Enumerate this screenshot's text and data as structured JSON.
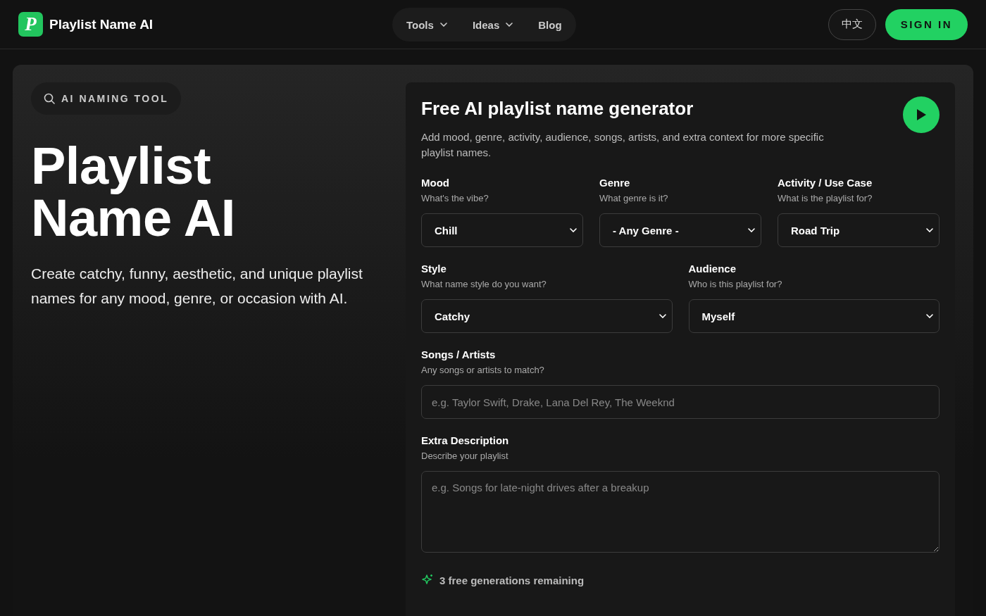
{
  "header": {
    "logo_letter": "P",
    "brand": "Playlist Name AI",
    "nav": [
      {
        "label": "Tools",
        "dropdown": true
      },
      {
        "label": "Ideas",
        "dropdown": true
      },
      {
        "label": "Blog",
        "dropdown": false
      }
    ],
    "language": "中文",
    "sign_in": "SIGN IN"
  },
  "hero": {
    "badge": "AI NAMING TOOL",
    "title_lines": [
      "Playlist",
      "Name AI"
    ],
    "subtitle": "Create catchy, funny, aesthetic, and unique playlist names for any mood, genre, or occasion with AI."
  },
  "generator": {
    "title": "Free AI playlist name generator",
    "description": "Add mood, genre, activity, audience, songs, artists, and extra context for more specific playlist names.",
    "field_groups": [
      {
        "fields": [
          {
            "kind": "select",
            "label": "Mood",
            "hint": "What's the vibe?",
            "value": "Chill"
          },
          {
            "kind": "select",
            "label": "Genre",
            "hint": "What genre is it?",
            "value": "- Any Genre -"
          },
          {
            "kind": "select",
            "label": "Activity / Use Case",
            "hint": "What is the playlist for?",
            "value": "Road Trip"
          }
        ]
      },
      {
        "fields": [
          {
            "kind": "select",
            "label": "Style",
            "hint": "What name style do you want?",
            "value": "Catchy"
          },
          {
            "kind": "select",
            "label": "Audience",
            "hint": "Who is this playlist for?",
            "value": "Myself"
          }
        ]
      },
      {
        "fields": [
          {
            "kind": "input",
            "label": "Songs / Artists",
            "hint": "Any songs or artists to match?",
            "placeholder": "e.g. Taylor Swift, Drake, Lana Del Rey, The Weeknd"
          }
        ]
      },
      {
        "fields": [
          {
            "kind": "textarea",
            "label": "Extra Description",
            "hint": "Describe your playlist",
            "placeholder": "e.g. Songs for late-night drives after a breakup"
          }
        ]
      }
    ],
    "remaining": "3 free generations remaining"
  }
}
